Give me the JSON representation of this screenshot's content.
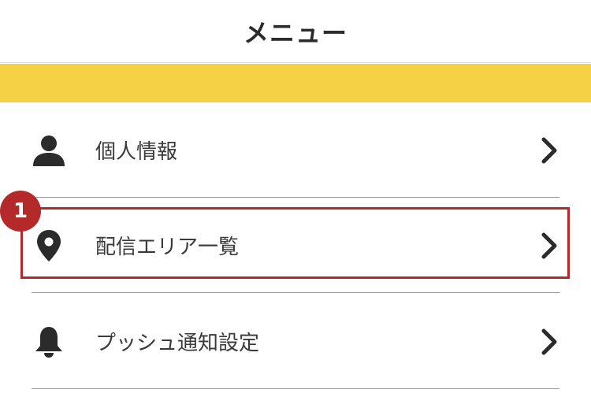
{
  "header": {
    "title": "メニュー"
  },
  "menu": {
    "items": [
      {
        "label": "個人情報",
        "icon": "person-icon"
      },
      {
        "label": "配信エリア一覧",
        "icon": "location-pin-icon"
      },
      {
        "label": "プッシュ通知設定",
        "icon": "bell-icon"
      }
    ]
  },
  "annotation": {
    "step_number": "1",
    "color": "#b42a2a"
  },
  "colors": {
    "banner": "#f5d245",
    "icon": "#2b2b2b"
  }
}
